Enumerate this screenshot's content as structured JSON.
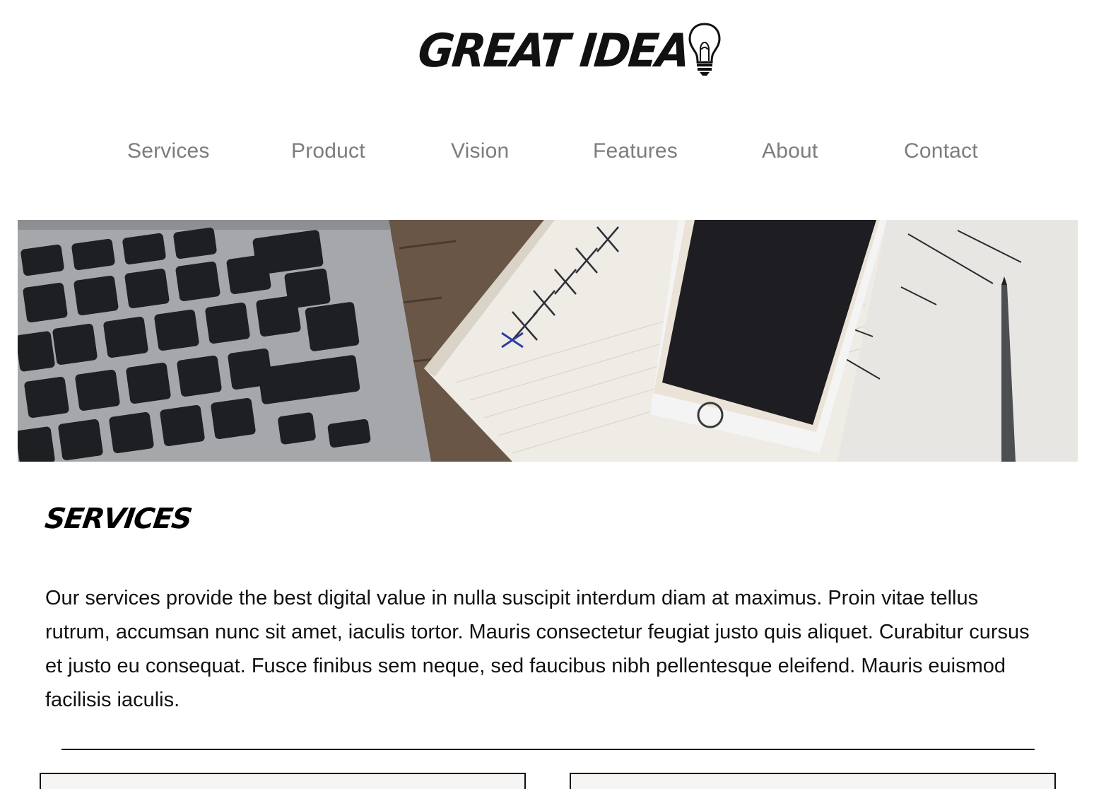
{
  "logo": {
    "text": "GREAT IDEA",
    "icon": "lightbulb-icon"
  },
  "nav": {
    "items": [
      {
        "label": "Services"
      },
      {
        "label": "Product"
      },
      {
        "label": "Vision"
      },
      {
        "label": "Features"
      },
      {
        "label": "About"
      },
      {
        "label": "Contact"
      }
    ]
  },
  "hero": {
    "image": "laptop-phone-notebook-photo"
  },
  "services": {
    "title": "Services",
    "body": "Our services provide the best digital value in nulla suscipit interdum diam at maximus. Proin vitae tellus rutrum, accumsan nunc sit amet, iaculis tortor. Mauris consectetur feugiat justo quis aliquet. Curabitur cursus et justo eu consequat. Fusce finibus sem neque, sed faucibus nibh pellentesque eleifend. Mauris euismod facilisis iaculis."
  },
  "colors": {
    "nav_text": "#7d7d7d",
    "body_text": "#111111",
    "background": "#ffffff"
  }
}
